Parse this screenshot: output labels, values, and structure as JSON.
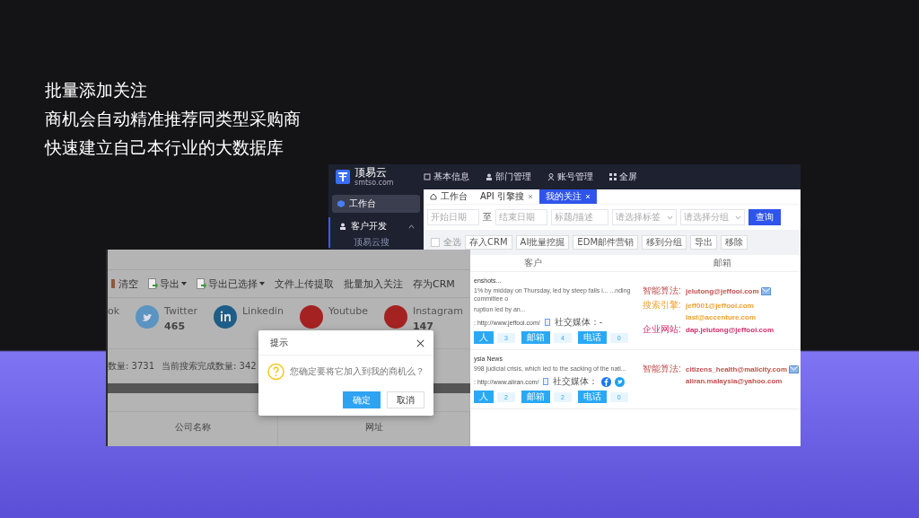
{
  "headline": [
    "批量添加关注",
    "商机会自动精准推荐同类型采购商",
    "快速建立自己本行业的大数据库"
  ],
  "crm_window": {
    "brand": {
      "name": "顶易云",
      "domain": "smtso.com"
    },
    "nav": [
      {
        "label": "基本信息",
        "kind": "info"
      },
      {
        "label": "部门管理",
        "kind": "dept"
      },
      {
        "label": "账号管理",
        "kind": "account"
      },
      {
        "label": "全屏",
        "kind": "fullscreen"
      }
    ],
    "sidebar": [
      {
        "label": "工作台",
        "selected": true,
        "kind": "workbench"
      },
      {
        "label": "客户开发",
        "selected": false,
        "expanded": true,
        "kind": "customers",
        "children": [
          {
            "label": "顶易云搜",
            "selected": false
          }
        ]
      }
    ],
    "tabs": [
      {
        "label": "工作台",
        "selected": false,
        "closable": false,
        "kind": "home"
      },
      {
        "label": "API 引擎搜",
        "selected": false,
        "closable": true,
        "kind": "plain"
      },
      {
        "label": "我的关注",
        "selected": true,
        "closable": true,
        "kind": "plain"
      }
    ],
    "filters": {
      "start_date": {
        "placeholder": "开始日期"
      },
      "separator": "至",
      "end_date": {
        "placeholder": "结束日期"
      },
      "keyword": {
        "placeholder": "标题/描述"
      },
      "tag_select": {
        "placeholder": "请选择标签"
      },
      "group_select": {
        "placeholder": "请选择分组"
      },
      "query_button": "查询"
    },
    "toolbar": {
      "select_all": {
        "label": "全选",
        "checked": false
      },
      "buttons": [
        "存入CRM",
        "AI批量挖掘",
        "EDM邮件营销",
        "移到分组",
        "导出",
        "移除"
      ]
    },
    "table": {
      "columns": [
        "客户",
        "邮箱"
      ],
      "rows": [
        {
          "title": "enshots...",
          "description": [
            "1% by midday on Thursday, led by steep falls i...  ...nding committee o",
            "ruption led by an..."
          ],
          "website": ": http://www.jeffooi.com/",
          "social_label": "社交媒体：-",
          "social": [],
          "badges": [
            {
              "label": "人",
              "count": "3"
            },
            {
              "label": "邮箱",
              "count": "4"
            },
            {
              "label": "电话",
              "count": "0"
            }
          ],
          "emails": [
            {
              "source": "智能算法:",
              "address": "jelutong@jeffooi.com",
              "color": "#c0504d",
              "mail_icon": true
            },
            {
              "source": "搜索引擎:",
              "address": "jeff001@jeffooi.com",
              "color": "#f0a030",
              "mail_icon": false
            },
            {
              "address": "last@accenture.com",
              "color": "#f0a030",
              "mail_icon": false
            },
            {
              "source": "企业网站:",
              "address": "dap.jelutong@jeffooi.com",
              "color": "#d0306a",
              "mail_icon": false
            }
          ]
        },
        {
          "title": "ysia News",
          "description": [
            "998 judicial crisis, which led to the sacking of the nati..."
          ],
          "website": ": http://www.aliran.com/",
          "social_label": "社交媒体：",
          "social": [
            {
              "kind": "facebook"
            },
            {
              "kind": "twitter"
            }
          ],
          "badges": [
            {
              "label": "人",
              "count": "2"
            },
            {
              "label": "邮箱",
              "count": "2"
            },
            {
              "label": "电话",
              "count": "0"
            }
          ],
          "emails": [
            {
              "source": "智能算法:",
              "address": "citizens_health@malicity.com",
              "color": "#c0504d",
              "mail_icon": true
            },
            {
              "address": "aliran.malaysia@yahoo.com",
              "color": "#c0504d",
              "mail_icon": false
            }
          ]
        }
      ]
    }
  },
  "search_window": {
    "toolbar": [
      {
        "label": "清空",
        "kind": "clear",
        "dropdown": false
      },
      {
        "label": "导出",
        "kind": "export",
        "dropdown": true
      },
      {
        "label": "导出已选择",
        "kind": "export",
        "dropdown": true
      },
      {
        "label": "文件上传提取",
        "kind": "plain",
        "dropdown": false
      },
      {
        "label": "批量加入关注",
        "kind": "plain",
        "dropdown": false
      },
      {
        "label": "存为CRM",
        "kind": "plain",
        "dropdown": false
      }
    ],
    "socials": [
      {
        "kind": "none",
        "name": "ok"
      },
      {
        "kind": "twitter",
        "name": "Twitter",
        "count": "465"
      },
      {
        "kind": "linkedin",
        "name": "Linkedin"
      },
      {
        "kind": "youtube",
        "name": "Youtube"
      },
      {
        "kind": "instagram",
        "name": "Instagram",
        "count": "147"
      }
    ],
    "stats": [
      "数量: 3731",
      "当前搜索完成数量: 342"
    ],
    "columns": [
      "公司名称",
      "网址"
    ]
  },
  "dialog": {
    "title": "提示",
    "message": "您确定要将它加入到我的商机么？",
    "buttons": [
      {
        "label": "确定",
        "primary": true
      },
      {
        "label": "取消",
        "primary": false
      }
    ]
  }
}
